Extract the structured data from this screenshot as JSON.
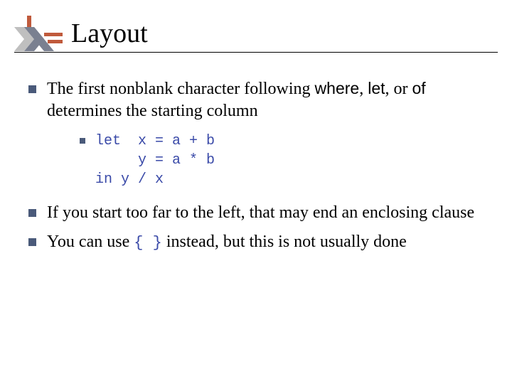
{
  "title": "Layout",
  "bullets": {
    "b1_pre": "The first nonblank character following ",
    "b1_kw1": "where",
    "b1_c1": ", ",
    "b1_kw2": "let",
    "b1_c2": ", or ",
    "b1_kw3": "of",
    "b1_post": " determines the starting column",
    "code_block": "let  x = a + b\n     y = a * b\nin y / x",
    "b2": "If you start too far to the left, that may end an enclosing clause",
    "b3_pre": "You can use ",
    "b3_code": "{ }",
    "b3_post": " instead, but this is not usually done"
  }
}
